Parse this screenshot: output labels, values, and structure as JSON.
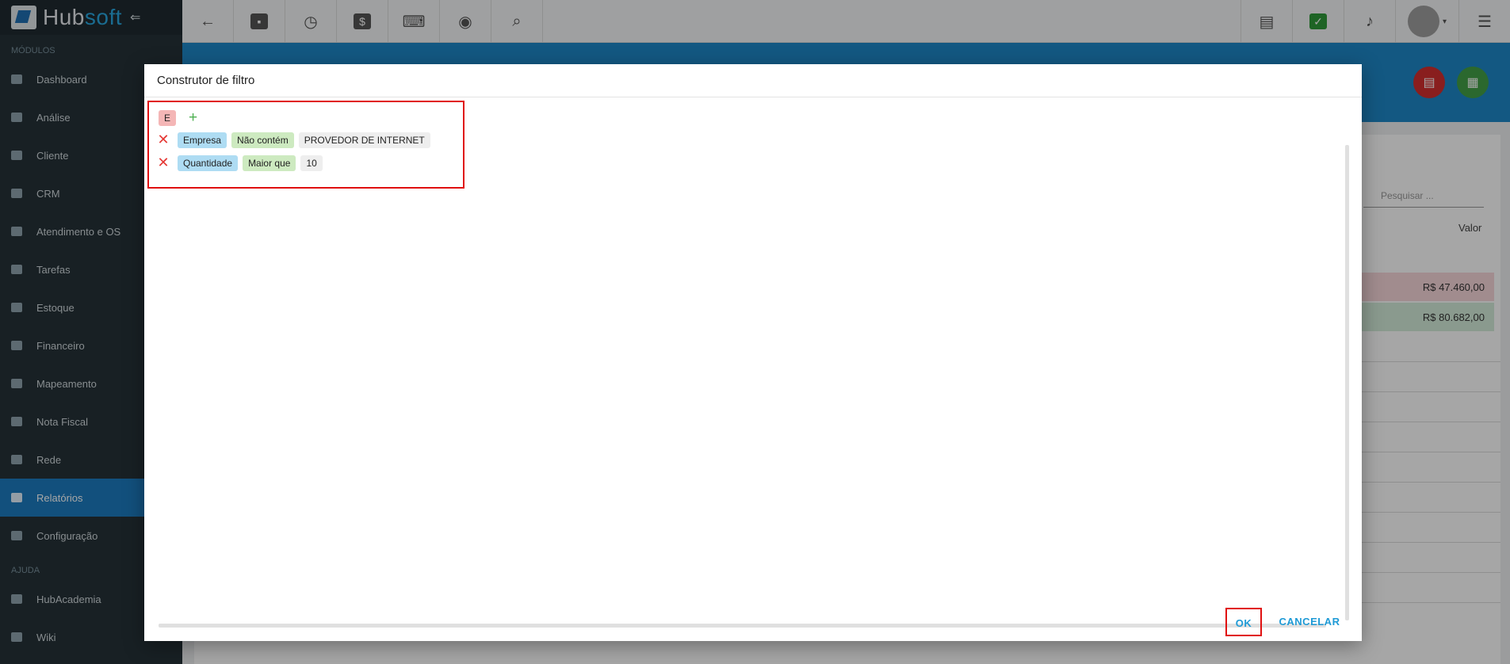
{
  "app": {
    "logo_hub": "Hub",
    "logo_soft": "soft"
  },
  "sidebar": {
    "modules_label": "MÓDULOS",
    "items": [
      {
        "label": "Dashboard",
        "icon": "dashboard-icon"
      },
      {
        "label": "Análise",
        "icon": "pie-chart-icon"
      },
      {
        "label": "Cliente",
        "icon": "contact-card-icon"
      },
      {
        "label": "CRM",
        "icon": "kanban-icon"
      },
      {
        "label": "Atendimento e OS",
        "icon": "calendar-clock-icon"
      },
      {
        "label": "Tarefas",
        "icon": "clipboard-icon"
      },
      {
        "label": "Estoque",
        "icon": "box-icon"
      },
      {
        "label": "Financeiro",
        "icon": "money-icon"
      },
      {
        "label": "Mapeamento",
        "icon": "map-pin-icon"
      },
      {
        "label": "Nota Fiscal",
        "icon": "invoice-icon"
      },
      {
        "label": "Rede",
        "icon": "server-icon"
      },
      {
        "label": "Relatórios",
        "icon": "report-icon",
        "active": true
      },
      {
        "label": "Configuração",
        "icon": "gear-icon"
      }
    ],
    "help_label": "AJUDA",
    "help_items": [
      {
        "label": "HubAcademia",
        "icon": "academy-icon"
      },
      {
        "label": "Wiki",
        "icon": "wiki-icon"
      }
    ]
  },
  "topbar": {
    "left_icons": [
      "back-arrow-icon",
      "contact-card-icon",
      "calendar-clock-icon",
      "dollar-icon",
      "terminal-icon",
      "eye-icon",
      "search-icon"
    ],
    "right_icons": [
      "pdf-icon",
      "checkmark-chat-icon",
      "bell-icon",
      "avatar",
      "list-menu-icon"
    ]
  },
  "background": {
    "search_placeholder": "Pesquisar ...",
    "col_valor": "Valor",
    "row1_value": "R$ 47.460,00",
    "row2_value": "R$ 80.682,00"
  },
  "modal": {
    "title": "Construtor de filtro",
    "group_operator": "E",
    "conditions": [
      {
        "field": "Empresa",
        "operator": "Não contém",
        "value": "PROVEDOR DE INTERNET"
      },
      {
        "field": "Quantidade",
        "operator": "Maior que",
        "value": "10"
      }
    ],
    "ok_label": "OK",
    "cancel_label": "CANCELAR"
  },
  "colors": {
    "sidebar_bg": "#263238",
    "accent": "#1c7cc0",
    "highlight_border": "#e01010",
    "button_text": "#1e9ad6"
  }
}
